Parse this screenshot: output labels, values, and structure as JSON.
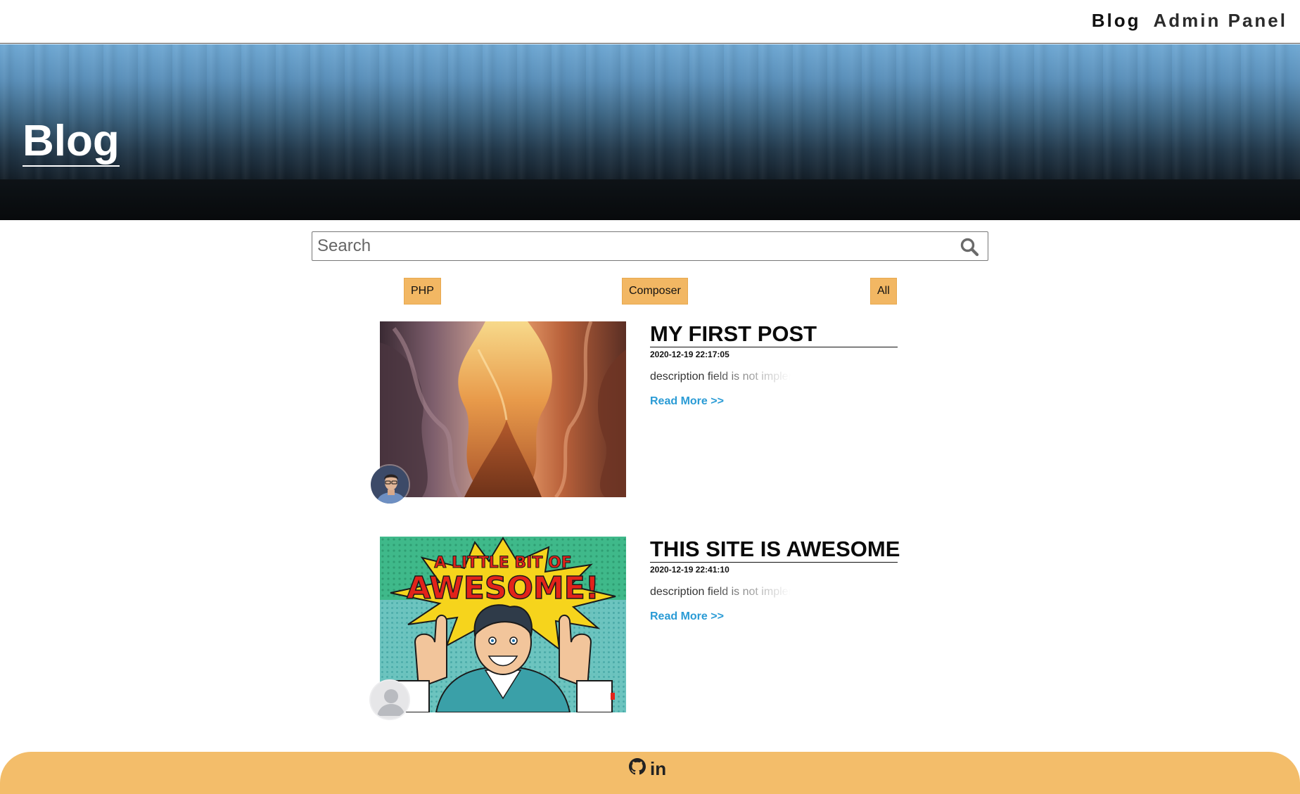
{
  "nav": {
    "blog_label": "Blog",
    "admin_label": "Admin Panel"
  },
  "hero": {
    "title": "Blog"
  },
  "search": {
    "placeholder": "Search"
  },
  "categories": [
    {
      "label": "PHP"
    },
    {
      "label": "Composer"
    },
    {
      "label": "All"
    }
  ],
  "posts": [
    {
      "title": "MY FIRST POST",
      "date": "2020-12-19 22:17:05",
      "description": "description field is not implemented yet",
      "read_more": "Read More >>",
      "image_icon": "canyon-image",
      "avatar_icon": "author-photo"
    },
    {
      "title": "THIS SITE IS AWESOME",
      "date": "2020-12-19 22:41:10",
      "description": "description field is not implemented yet",
      "read_more": "Read More >>",
      "image_icon": "comic-awesome-image",
      "avatar_icon": "default-user-avatar",
      "image_text_line1": "A LITTLE BIT OF",
      "image_text_line2": "AWESOME!"
    }
  ],
  "footer": {
    "icons": [
      "github-icon",
      "linkedin-icon"
    ],
    "linkedin_text": "in"
  },
  "colors": {
    "accent": "#f3bd6a",
    "category_button": "#f2b763",
    "link": "#2a9bd5"
  }
}
